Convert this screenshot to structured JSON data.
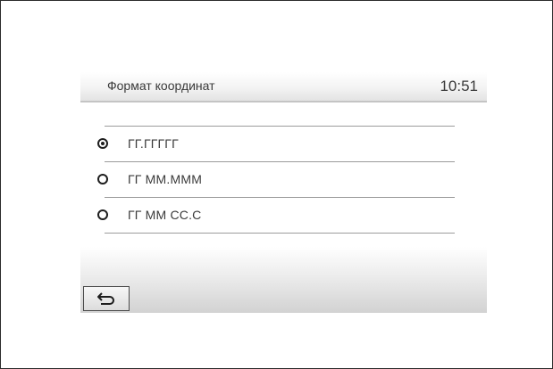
{
  "header": {
    "title": "Формат координат",
    "time": "10:51"
  },
  "options": [
    {
      "label": "ГГ.ГГГГГ",
      "selected": true
    },
    {
      "label": "ГГ ММ.МММ",
      "selected": false
    },
    {
      "label": "ГГ ММ СС.С",
      "selected": false
    }
  ],
  "footer": {
    "back_icon": "back-arrow-icon"
  }
}
